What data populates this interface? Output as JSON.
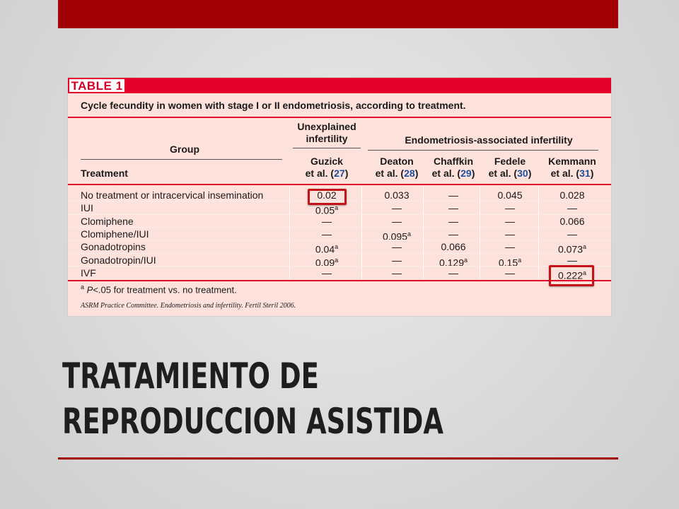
{
  "table": {
    "label": "TABLE 1",
    "caption": "Cycle fecundity in women with stage I or II endometriosis, according to treatment.",
    "header": {
      "group": "Group",
      "treatment": "Treatment",
      "unexplained": [
        "Unexplained",
        "infertility"
      ],
      "endometriosis": "Endometriosis-associated infertility"
    },
    "columns": [
      {
        "author": "Guzick",
        "etal": "et al. (",
        "ref": "27",
        "close": ")"
      },
      {
        "author": "Deaton",
        "etal": "et al. (",
        "ref": "28",
        "close": ")"
      },
      {
        "author": "Chaffkin",
        "etal": "et al. (",
        "ref": "29",
        "close": ")"
      },
      {
        "author": "Fedele",
        "etal": "et al. (",
        "ref": "30",
        "close": ")"
      },
      {
        "author": "Kemmann",
        "etal": "et al. (",
        "ref": "31",
        "close": ")"
      }
    ],
    "rows": [
      {
        "treatment": "No treatment or intracervical insemination",
        "values": [
          "0.02",
          "0.033",
          "—",
          "0.045",
          "0.028"
        ],
        "sup": [
          "",
          "",
          "",
          "",
          ""
        ]
      },
      {
        "treatment": "IUI",
        "values": [
          "0.05",
          "—",
          "—",
          "—",
          "—"
        ],
        "sup": [
          "a",
          "",
          "",
          "",
          ""
        ]
      },
      {
        "treatment": "Clomiphene",
        "values": [
          "—",
          "—",
          "—",
          "—",
          "0.066"
        ],
        "sup": [
          "",
          "",
          "",
          "",
          ""
        ]
      },
      {
        "treatment": "Clomiphene/IUI",
        "values": [
          "—",
          "0.095",
          "—",
          "—",
          "—"
        ],
        "sup": [
          "",
          "a",
          "",
          "",
          ""
        ]
      },
      {
        "treatment": "Gonadotropins",
        "values": [
          "0.04",
          "—",
          "0.066",
          "—",
          "0.073"
        ],
        "sup": [
          "a",
          "",
          "",
          "",
          "a"
        ]
      },
      {
        "treatment": "Gonadotropin/IUI",
        "values": [
          "0.09",
          "—",
          "0.129",
          "0.15",
          "—"
        ],
        "sup": [
          "a",
          "",
          "a",
          "a",
          ""
        ]
      },
      {
        "treatment": "IVF",
        "values": [
          "—",
          "—",
          "—",
          "—",
          "0.222"
        ],
        "sup": [
          "",
          "",
          "",
          "",
          "a"
        ]
      }
    ],
    "footnote": {
      "sup": "a",
      "italic": "P",
      "text": "<.05 for treatment vs. no treatment."
    },
    "citation": "ASRM Practice Committee. Endometriosis and infertility. Fertil Steril 2006."
  },
  "slide_title": [
    "TRATAMIENTO DE",
    "REPRODUCCION ASISTIDA"
  ],
  "colors": {
    "accent_red": "#a30005",
    "table_pink": "#fde2dc",
    "table_red": "#e4002b",
    "highlight": "#c4121a"
  }
}
